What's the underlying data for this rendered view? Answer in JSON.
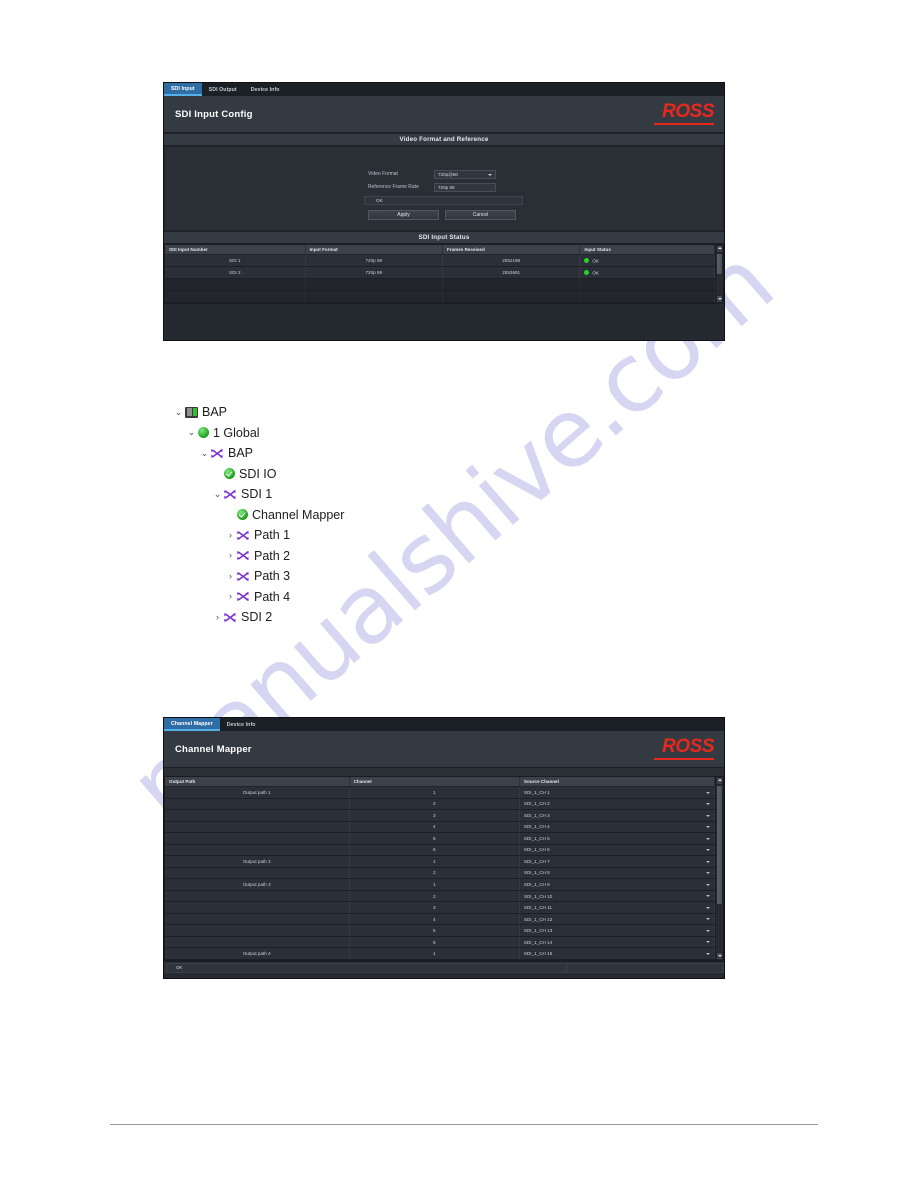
{
  "watermark": {
    "text": "manualshive.com"
  },
  "brand": {
    "logo_text": "ROSS",
    "logo_color": "#e8281c"
  },
  "sdi_input_panel": {
    "tabs": [
      {
        "label": "SDI Input",
        "active": true
      },
      {
        "label": "SDI Output",
        "active": false
      },
      {
        "label": "Device Info",
        "active": false
      }
    ],
    "title": "SDI Input Config",
    "video_format_section": {
      "band_label": "Video Format and Reference",
      "fields": [
        {
          "label": "Video Format",
          "value": "720p@60",
          "type": "select"
        },
        {
          "label": "Reference Frame Rate",
          "value": "720p 59",
          "type": "text"
        }
      ],
      "status": {
        "led": "green",
        "text": "OK"
      },
      "buttons": [
        {
          "label": "Apply"
        },
        {
          "label": "Cancel"
        }
      ]
    },
    "status_section": {
      "band_label": "SDI Input Status",
      "columns": [
        "SDI Input Number",
        "Input Format",
        "Frames Received",
        "Input Status"
      ],
      "rows": [
        {
          "number": "SDI 1",
          "format": "720p 59",
          "frames": "2552198",
          "status": "OK",
          "led": "green"
        },
        {
          "number": "SDI 2",
          "format": "720p 59",
          "frames": "2553691",
          "status": "OK",
          "led": "green"
        }
      ]
    }
  },
  "tree": {
    "nodes": [
      {
        "depth": 0,
        "twisty": "open",
        "icon": "device-icon",
        "label": "BAP"
      },
      {
        "depth": 1,
        "twisty": "open",
        "icon": "status-ok-icon",
        "label": "1 Global"
      },
      {
        "depth": 2,
        "twisty": "open",
        "icon": "crossing-arrows-icon",
        "label": "BAP"
      },
      {
        "depth": 3,
        "twisty": "none",
        "icon": "check-circle-icon",
        "label": "SDI IO"
      },
      {
        "depth": 3,
        "twisty": "open",
        "icon": "crossing-arrows-icon",
        "label": "SDI 1"
      },
      {
        "depth": 4,
        "twisty": "none",
        "icon": "check-circle-icon",
        "label": "Channel Mapper"
      },
      {
        "depth": 4,
        "twisty": "closed",
        "icon": "crossing-arrows-icon",
        "label": "Path 1"
      },
      {
        "depth": 4,
        "twisty": "closed",
        "icon": "crossing-arrows-icon",
        "label": "Path 2"
      },
      {
        "depth": 4,
        "twisty": "closed",
        "icon": "crossing-arrows-icon",
        "label": "Path 3"
      },
      {
        "depth": 4,
        "twisty": "closed",
        "icon": "crossing-arrows-icon",
        "label": "Path 4"
      },
      {
        "depth": 3,
        "twisty": "closed",
        "icon": "crossing-arrows-icon",
        "label": "SDI 2"
      }
    ]
  },
  "channel_mapper_panel": {
    "tabs": [
      {
        "label": "Channel Mapper",
        "active": true
      },
      {
        "label": "Device Info",
        "active": false
      }
    ],
    "title": "Channel Mapper",
    "columns": [
      "Output Path",
      "Channel",
      "Source Channel"
    ],
    "rows": [
      {
        "path": "Output path 1",
        "channel": "1",
        "source": "SDI_1_CH 1"
      },
      {
        "path": "",
        "channel": "2",
        "source": "SDI_1_CH 2"
      },
      {
        "path": "",
        "channel": "3",
        "source": "SDI_1_CH 3"
      },
      {
        "path": "",
        "channel": "4",
        "source": "SDI_1_CH 4"
      },
      {
        "path": "",
        "channel": "5",
        "source": "SDI_1_CH 5"
      },
      {
        "path": "",
        "channel": "6",
        "source": "SDI_1_CH 6"
      },
      {
        "path": "Output path 2",
        "channel": "1",
        "source": "SDI_1_CH 7"
      },
      {
        "path": "",
        "channel": "2",
        "source": "SDI_1_CH 8"
      },
      {
        "path": "Output path 3",
        "channel": "1",
        "source": "SDI_1_CH 9"
      },
      {
        "path": "",
        "channel": "2",
        "source": "SDI_1_CH 10"
      },
      {
        "path": "",
        "channel": "3",
        "source": "SDI_1_CH 11"
      },
      {
        "path": "",
        "channel": "4",
        "source": "SDI_1_CH 12"
      },
      {
        "path": "",
        "channel": "5",
        "source": "SDI_1_CH 13"
      },
      {
        "path": "",
        "channel": "6",
        "source": "SDI_1_CH 14"
      },
      {
        "path": "Output path 4",
        "channel": "1",
        "source": "SDI_1_CH 15"
      }
    ],
    "status": {
      "led": "green",
      "text": "OK"
    }
  }
}
